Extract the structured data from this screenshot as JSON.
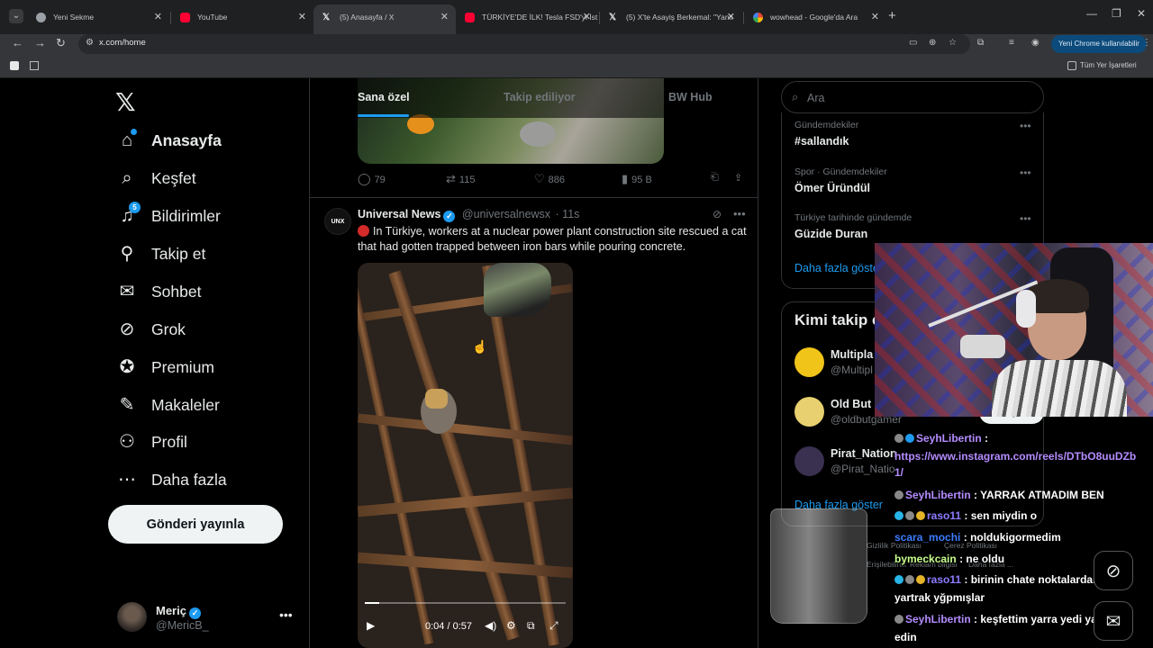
{
  "browser": {
    "tabs": [
      {
        "label": "Yeni Sekme",
        "favicon_color": "#9aa0a6"
      },
      {
        "label": "YouTube",
        "favicon_color": "#ff0033"
      },
      {
        "label": "(5) Anasayfa / X",
        "favicon_color": "#e7e9ea"
      },
      {
        "label": "TÜRKİYE'DE İLK! Tesla FSD'yi İst",
        "favicon_color": "#ff0033"
      },
      {
        "label": "(5) X'te Asayiş Berkemal: \"Yanlı",
        "favicon_color": "#e7e9ea"
      },
      {
        "label": "wowhead - Google'da Ara",
        "favicon_color": "#4285f4"
      }
    ],
    "url": "x.com/home",
    "chrome_badge": "Yeni Chrome kullanılabilir",
    "all_bookmarks": "Tüm Yer İşaretleri"
  },
  "nav": {
    "items": [
      {
        "label": "Anasayfa",
        "icon": "home-icon",
        "glyph": "⌂"
      },
      {
        "label": "Keşfet",
        "icon": "search-icon",
        "glyph": "⌕"
      },
      {
        "label": "Bildirimler",
        "icon": "bell-icon",
        "glyph": "🔔︎",
        "badge": "5"
      },
      {
        "label": "Takip et",
        "icon": "person-add-icon",
        "glyph": "👤︎"
      },
      {
        "label": "Sohbet",
        "icon": "mail-icon",
        "glyph": "✉"
      },
      {
        "label": "Grok",
        "icon": "grok-icon",
        "glyph": "⊘"
      },
      {
        "label": "Premium",
        "icon": "premium-icon",
        "glyph": "✪"
      },
      {
        "label": "Makaleler",
        "icon": "articles-icon",
        "glyph": "✎"
      },
      {
        "label": "Profil",
        "icon": "profile-icon",
        "glyph": "⚇"
      },
      {
        "label": "Daha fazla",
        "icon": "more-circle-icon",
        "glyph": "⋯"
      }
    ],
    "post_button": "Gönderi yayınla",
    "account": {
      "name": "Meriç",
      "handle": "@MericB_"
    }
  },
  "feed": {
    "tabs": [
      "Sana özel",
      "Takip ediliyor",
      "BW Hub"
    ],
    "prev_post_actions": {
      "replies": "79",
      "reposts": "115",
      "likes": "886",
      "views": "95 B"
    },
    "tweet": {
      "avatar_text": "UNX",
      "name": "Universal News",
      "handle": "@universalnewsx",
      "time": "· 11s",
      "text": "In Türkiye, workers at a nuclear power plant construction site rescued a cat that had gotten trapped between iron bars while pouring concrete.",
      "video_time": "0:04 / 0:57",
      "video_progress": 0.07
    }
  },
  "sidebar": {
    "search_placeholder": "Ara",
    "trends": [
      {
        "context": "Gündemdekiler",
        "title": "#sallandık"
      },
      {
        "context": "Spor · Gündemdekiler",
        "title": "Ömer Üründül"
      },
      {
        "context": "Türkiye tarihinde gündemde",
        "title": "Güzide Duran"
      }
    ],
    "trends_show_more": "Daha fazla göster",
    "who_to_follow_title": "Kimi takip e",
    "who_to_follow": [
      {
        "name": "Multipla",
        "handle": "@Multipl",
        "avatar_color": "#f0c419"
      },
      {
        "name": "Old But",
        "handle": "@oldbutgamer",
        "avatar_color": "#e8d070"
      },
      {
        "name": "Pirat_Nation",
        "handle": "@Pirat_Natio",
        "avatar_color": "#3a3050"
      }
    ],
    "follow_label": "Takip et",
    "wtf_show_more": "Daha fazla göster",
    "footer": [
      "Gizlilik Politikası",
      "Çerez Politikası",
      "Erişilebilirlik",
      "Reklam bilgisi",
      "Daha fazla ..."
    ]
  },
  "stream_chat": [
    {
      "user": "SeyhLibertin",
      "user_color": "#b48cff",
      "message": ":"
    },
    {
      "user": "",
      "user_color": "#b48cff",
      "message": "https://www.instagram.com/reels/DTbO8uuDZb",
      "is_link": true
    },
    {
      "user": "",
      "user_color": "#b48cff",
      "message": "1/"
    },
    {
      "user": "SeyhLibertin",
      "user_color": "#b48cff",
      "message": ": YARRAK ATMADIM BEN"
    },
    {
      "user": "raso11",
      "user_color": "#8c7cff",
      "message": ": sen miydin o"
    },
    {
      "user": "scara_mochi",
      "user_color": "#3c7cff",
      "message": ": noldukigormedim"
    },
    {
      "user": "bymeckcain",
      "user_color": "#c8ff8c",
      "message": ": ne oldu"
    },
    {
      "user": "raso11",
      "user_color": "#8c7cff",
      "message": ": birinin chate noktalardan"
    },
    {
      "user": "",
      "user_color": "#fff",
      "message": "yartrak yğpmışlar"
    },
    {
      "user": "SeyhLibertin",
      "user_color": "#b48cff",
      "message": ": keşfettim yarra yedi yardım"
    },
    {
      "user": "",
      "user_color": "#fff",
      "message": "edin"
    }
  ]
}
